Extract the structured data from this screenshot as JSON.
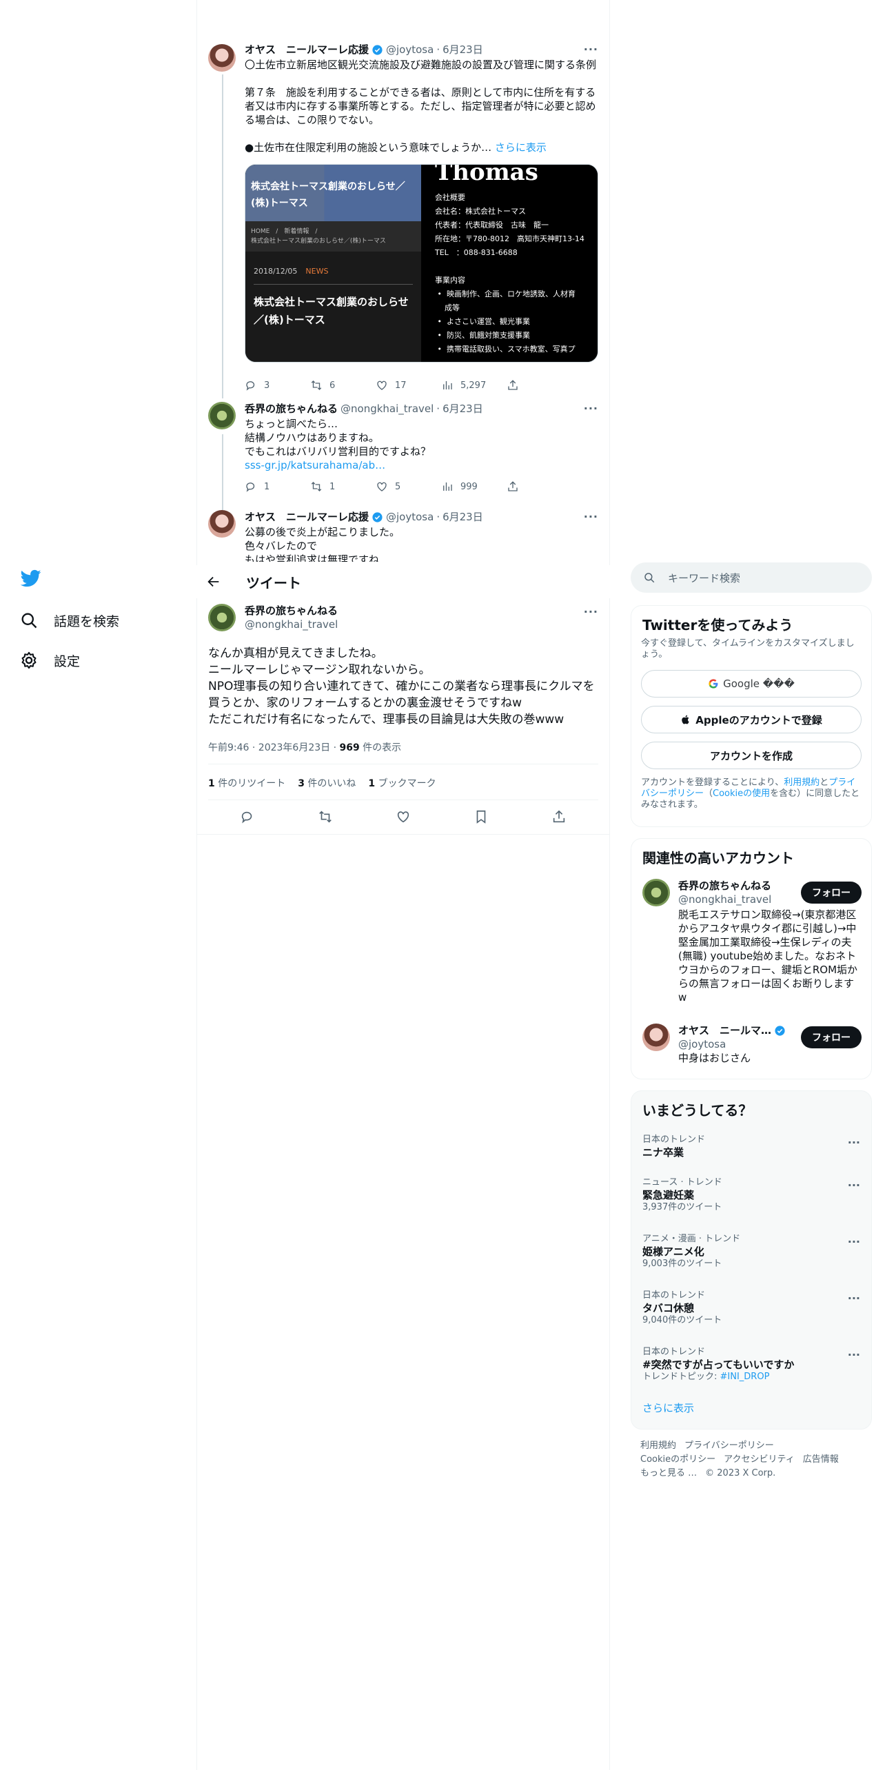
{
  "nav": {
    "explore_label": "話題を検索",
    "settings_label": "設定"
  },
  "thread": {
    "tweet1": {
      "name": "オヤス　ニールマーレ応援",
      "handle": "@joytosa",
      "time": "6月23日",
      "text": "〇土佐市立新居地区観光交流施設及び避難施設の設置及び管理に関する条例\n\n第７条　施設を利用することができる者は、原則として市内に住所を有する者又は市内に存する事業所等とする。ただし、指定管理者が特に必要と認める場合は、この限りでない。\n\n●土佐市在住限定利用の施設という意味でしょうか…",
      "show_more": "さらに表示",
      "card": {
        "banner_title": "株式会社トーマス創業のおしらせ／(株)トーマス",
        "crumb": "HOME　/　新着情報　/\n株式会社トーマス創業のおしらせ／(株)トーマス",
        "date": "2018/12/05",
        "tag": "NEWS",
        "title": "株式会社トーマス創業のおしらせ／(株)トーマス",
        "right_title": "Thomas",
        "right_info": "会社概要\n会社名：株式会社トーマス\n代表者：代表取締役　古味　龍一\n所在地：〒780-8012　高知市天神町13-14\nTEL　：088-831-6688\n\n事業内容\n •  映画制作、企画、ロケ地誘致、人材育\n    成等\n •  よさこい運営、観光事業\n •  防災、飢餓対策支援事業\n •  携帯電話取扱い、スマホ教室、写真プ"
      },
      "replies": "3",
      "retweets": "6",
      "likes": "17",
      "views": "5,297"
    },
    "tweet2": {
      "name": "呑界の旅ちゃんねる",
      "handle": "@nongkhai_travel",
      "time": "6月23日",
      "text": "ちょっと調べたら…\n結構ノウハウはありますね。\nでもこれはバリバリ営利目的ですよね？",
      "link": "sss-gr.jp/katsurahama/ab…",
      "replies": "1",
      "retweets": "1",
      "likes": "5",
      "views": "999"
    },
    "tweet3": {
      "name": "オヤス　ニールマーレ応援",
      "handle": "@joytosa",
      "time": "6月23日",
      "text": "公募の後で炎上が起こりました。\n色々バレたので\nもはや営利追求は無理ですね"
    }
  },
  "main": {
    "header_title": "ツイート",
    "author_name": "呑界の旅ちゃんねる",
    "author_handle": "@nongkhai_travel",
    "text": "なんか真相が見えてきましたね。\nニールマーレじゃマージン取れないから。\nNPO理事長の知り合い連れてきて、確かにこの業者なら理事長にクルマを買うとか、家のリフォームするとかの裏金渡せそうですねw\nただこれだけ有名になったんで、理事長の目論見は大失敗の巻www",
    "timestamp": "午前9:46 · 2023年6月23日 · ",
    "views_count": "969",
    "views_label": " 件の表示",
    "retweets_count": "1",
    "retweets_label": " 件のリツイート",
    "likes_count": "3",
    "likes_label": " 件のいいね",
    "bookmarks_count": "1",
    "bookmarks_label": " ブックマーク"
  },
  "sidebar": {
    "search_placeholder": "キーワード検索",
    "signup": {
      "title": "Twitterを使ってみよう",
      "subtitle": "今すぐ登録して、タイムラインをカスタマイズしましょう。",
      "google_label": "Google ���",
      "apple_label": "Appleのアカウントで登録",
      "create_label": "アカウントを作成",
      "legal_pre": "アカウントを登録することにより、",
      "legal_terms": "利用規約",
      "legal_and": "と",
      "legal_privacy": "プライバシーポリシー",
      "legal_mid": "（",
      "legal_cookie": "Cookieの使用",
      "legal_post": "を含む）に同意したとみなされます。"
    },
    "relevant": {
      "title": "関連性の高いアカウント",
      "follow_label": "フォロー",
      "accounts": [
        {
          "name": "呑界の旅ちゃんねる",
          "handle": "@nongkhai_travel",
          "bio": "脱毛エステサロン取締役→(東京都港区からアユタヤ県ウタイ郡に引越し)→中堅金属加工業取締役→生保レディの夫(無職) youtube始めました。なおネトウヨからのフォロー、鍵垢とROM垢からの無言フォローは固くお断りしますw"
        },
        {
          "name": "オヤス　ニールマ…",
          "handle": "@joytosa",
          "bio": "中身はおじさん"
        }
      ]
    },
    "trends": {
      "title": "いまどうしてる？",
      "items": [
        {
          "ctx": "日本のトレンド",
          "title": "ニナ卒業",
          "count": ""
        },
        {
          "ctx": "ニュース · トレンド",
          "title": "緊急避妊薬",
          "count": "3,937件のツイート"
        },
        {
          "ctx": "アニメ・漫画 · トレンド",
          "title": "姫様アニメ化",
          "count": "9,003件のツイート"
        },
        {
          "ctx": "日本のトレンド",
          "title": "タバコ休憩",
          "count": "9,040件のツイート"
        },
        {
          "ctx": "日本のトレンド",
          "title": "#突然ですが占ってもいいですか",
          "count": "トレンドトピック: ",
          "topic": "#INI_DROP"
        }
      ],
      "show_more": "さらに表示"
    },
    "footer": {
      "links": [
        "利用規約",
        "プライバシーポリシー",
        "Cookieのポリシー",
        "アクセシビリティ",
        "広告情報",
        "もっと見る …"
      ],
      "copyright": "© 2023 X Corp."
    }
  }
}
